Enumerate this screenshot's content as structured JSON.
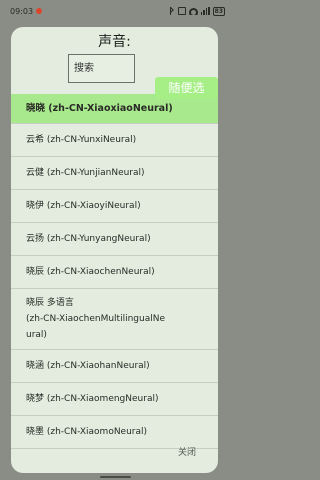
{
  "status_bar": {
    "time": "09:03",
    "battery": "83"
  },
  "dialog": {
    "title": "声音:",
    "search": {
      "value": "",
      "placeholder": "搜索"
    },
    "random_label": "随便选",
    "close_label": "关闭",
    "voices": [
      {
        "label": "晓晓 (zh-CN-XiaoxiaoNeural)",
        "selected": true
      },
      {
        "label": "云希 (zh-CN-YunxiNeural)",
        "selected": false
      },
      {
        "label": "云健 (zh-CN-YunjianNeural)",
        "selected": false
      },
      {
        "label": "晓伊 (zh-CN-XiaoyiNeural)",
        "selected": false
      },
      {
        "label": "云扬 (zh-CN-YunyangNeural)",
        "selected": false
      },
      {
        "label": "晓辰 (zh-CN-XiaochenNeural)",
        "selected": false
      },
      {
        "label_lines": [
          "晓辰 多语言",
          "(zh-CN-XiaochenMultilingualNe",
          "ural)"
        ],
        "selected": false
      },
      {
        "label": "晓涵 (zh-CN-XiaohanNeural)",
        "selected": false
      },
      {
        "label": "晓梦 (zh-CN-XiaomengNeural)",
        "selected": false
      },
      {
        "label": "晓墨 (zh-CN-XiaomoNeural)",
        "selected": false
      }
    ]
  },
  "colors": {
    "selected_bg": "#a9e98d",
    "random_button_bg": "#a6ee86",
    "dialog_bg": "#e3ecdf"
  },
  "icons": {
    "status": [
      "app-notification-icon",
      "bluetooth-icon",
      "silent-icon",
      "wifi-icon",
      "signal-icon",
      "battery-icon"
    ]
  }
}
